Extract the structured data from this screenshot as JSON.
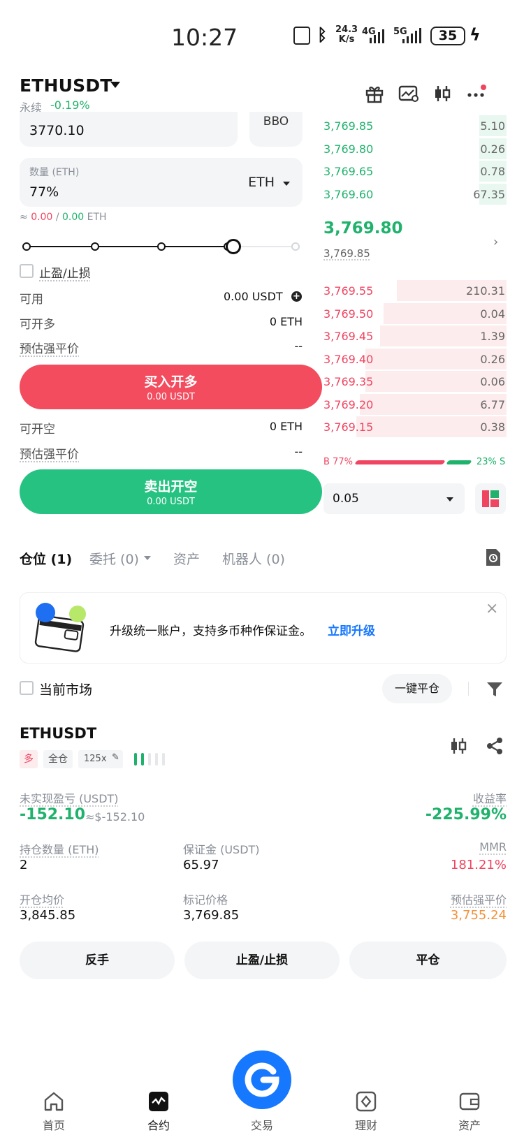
{
  "status_bar": {
    "time": "10:27",
    "speed": "24.3",
    "speed_unit": "K/s",
    "net1": "4G",
    "net2": "5G",
    "battery": "35"
  },
  "header": {
    "pair": "ETHUSDT",
    "type": "永续",
    "change": "-0.19%"
  },
  "order_form": {
    "price_value": "3770.10",
    "bbo_label": "BBO",
    "qty_label": "数量 (ETH)",
    "qty_value": "77%",
    "qty_unit": "ETH",
    "approx_prefix": "≈",
    "approx_buy": "0.00",
    "approx_sep": "/",
    "approx_sell": "0.00",
    "approx_unit": "ETH",
    "slider_percent": 77,
    "tpsl_label": "止盈/止损",
    "available_label": "可用",
    "available_value": "0.00",
    "available_unit": "USDT",
    "max_long_label": "可开多",
    "max_long_value": "0 ETH",
    "liq_price_label": "预估强平价",
    "liq_price_value": "--",
    "buy_btn": "买入开多",
    "buy_btn_sub": "0.00 USDT",
    "max_short_label": "可开空",
    "max_short_value": "0 ETH",
    "liq_price_label2": "预估强平价",
    "liq_price_value2": "--",
    "sell_btn": "卖出开空",
    "sell_btn_sub": "0.00 USDT"
  },
  "orderbook": {
    "bids_top": [
      {
        "price": "3,769.85",
        "qty": "5.10",
        "depth": 0.15
      },
      {
        "price": "3,769.80",
        "qty": "0.26",
        "depth": 0.15
      },
      {
        "price": "3,769.65",
        "qty": "0.78",
        "depth": 0.15
      },
      {
        "price": "3,769.60",
        "qty": "67.35",
        "depth": 0.15
      }
    ],
    "last_price": "3,769.80",
    "mark_price": "3,769.85",
    "asks": [
      {
        "price": "3,769.55",
        "qty": "210.31",
        "depth": 0.6
      },
      {
        "price": "3,769.50",
        "qty": "0.04",
        "depth": 0.67
      },
      {
        "price": "3,769.45",
        "qty": "1.39",
        "depth": 0.69
      },
      {
        "price": "3,769.40",
        "qty": "0.26",
        "depth": 0.77
      },
      {
        "price": "3,769.35",
        "qty": "0.06",
        "depth": 0.77
      },
      {
        "price": "3,769.20",
        "qty": "6.77",
        "depth": 0.8
      },
      {
        "price": "3,769.15",
        "qty": "0.38",
        "depth": 0.82
      }
    ],
    "ratio_buy_label": "B 77%",
    "ratio_sell_label": "23% S",
    "ratio_buy": 77,
    "precision": "0.05"
  },
  "tabs": [
    {
      "label": "仓位 (1)"
    },
    {
      "label": "委托 (0)"
    },
    {
      "label": "资产"
    },
    {
      "label": "机器人 (0)"
    }
  ],
  "banner": {
    "text": "升级统一账户，支持多币种作保证金。",
    "link": "立即升级"
  },
  "filter": {
    "current_market": "当前市场",
    "close_all": "一键平仓"
  },
  "position": {
    "symbol": "ETHUSDT",
    "side": "多",
    "margin_mode": "全仓",
    "leverage": "125x",
    "upnl_label": "未实现盈亏 (USDT)",
    "upnl_value": "-152.10",
    "upnl_approx": "≈$-152.10",
    "roe_label": "收益率",
    "roe_value": "-225.99%",
    "size_label": "持仓数量 (ETH)",
    "size_value": "2",
    "margin_label": "保证金 (USDT)",
    "margin_value": "65.97",
    "mmr_label": "MMR",
    "mmr_value": "181.21%",
    "entry_label": "开仓均价",
    "entry_value": "3,845.85",
    "mark_label": "标记价格",
    "mark_value": "3,769.85",
    "liq_label": "预估强平价",
    "liq_value": "3,755.24",
    "actions": [
      "反手",
      "止盈/止损",
      "平仓"
    ]
  },
  "nav": [
    {
      "label": "首页",
      "icon": "home-icon"
    },
    {
      "label": "合约",
      "icon": "futures-icon"
    },
    {
      "label": "交易",
      "icon": "trade-icon"
    },
    {
      "label": "理财",
      "icon": "earn-icon"
    },
    {
      "label": "资产",
      "icon": "wallet-icon"
    }
  ],
  "colors": {
    "green": "#20b26c",
    "red": "#ef4560",
    "orange": "#f2913b",
    "accent": "#1677ff"
  }
}
